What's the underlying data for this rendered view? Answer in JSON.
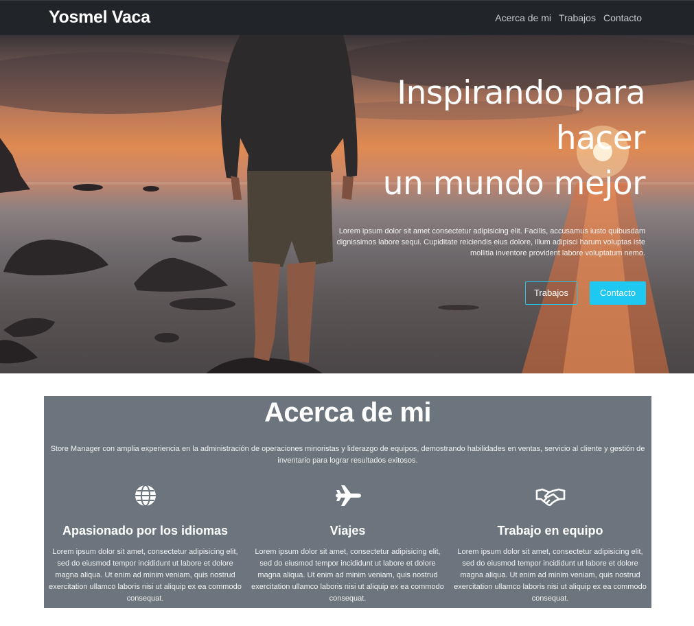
{
  "nav": {
    "brand": "Yosmel Vaca",
    "links": [
      "Acerca de mi",
      "Trabajos",
      "Contacto"
    ]
  },
  "hero": {
    "title": "Inspirando para\nhacer\nun mundo mejor",
    "description": "Lorem ipsum dolor sit amet consectetur adipisicing elit. Facilis, accusamus iusto quibusdam dignissimos labore sequi. Cupiditate reiciendis eius dolore, illum adipisci harum voluptas iste mollitia inventore provident labore voluptatum nemo.",
    "buttons": {
      "primary_outline": "Trabajos",
      "primary_fill": "Contacto"
    }
  },
  "about": {
    "title": "Acerca de mi",
    "description": "Store Manager con amplia experiencia en la administración de operaciones minoristas y liderazgo de equipos, demostrando habilidades en ventas, servicio al cliente y gestión de inventario para lograr resultados exitosos.",
    "features": [
      {
        "icon": "globe-icon",
        "title": "Apasionado por los idiomas",
        "text": "Lorem ipsum dolor sit amet, consectetur adipisicing elit, sed do eiusmod tempor incididunt ut labore et dolore magna aliqua. Ut enim ad minim veniam, quis nostrud exercitation ullamco laboris nisi ut aliquip ex ea commodo consequat."
      },
      {
        "icon": "plane-icon",
        "title": "Viajes",
        "text": "Lorem ipsum dolor sit amet, consectetur adipisicing elit, sed do eiusmod tempor incididunt ut labore et dolore magna aliqua. Ut enim ad minim veniam, quis nostrud exercitation ullamco laboris nisi ut aliquip ex ea commodo consequat."
      },
      {
        "icon": "handshake-icon",
        "title": "Trabajo en equipo",
        "text": "Lorem ipsum dolor sit amet, consectetur adipisicing elit, sed do eiusmod tempor incididunt ut labore et dolore magna aliqua. Ut enim ad minim veniam, quis nostrud exercitation ullamco laboris nisi ut aliquip ex ea commodo consequat."
      }
    ]
  },
  "colors": {
    "navbar": "#212529",
    "accent": "#1ec8f0",
    "about_bg": "#6c757d"
  }
}
